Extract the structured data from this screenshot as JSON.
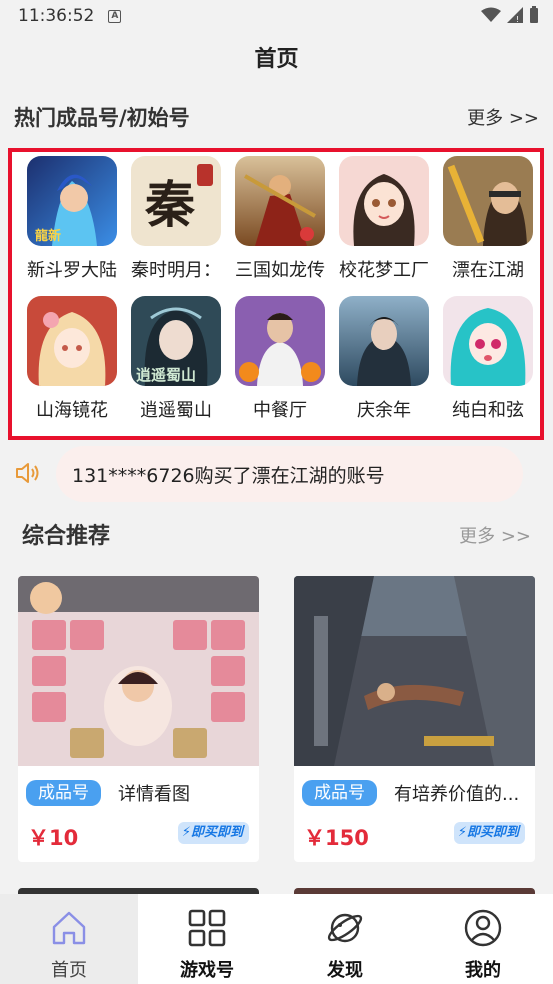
{
  "status": {
    "time": "11:36:52"
  },
  "header": {
    "title": "首页"
  },
  "hot": {
    "title": "热门成品号/初始号",
    "more": "更多 >>",
    "games": [
      {
        "name": "新斗罗大陆",
        "icon": "game-icon-xin-douluo",
        "badge": "龍新"
      },
      {
        "name": "秦时明月：",
        "icon": "game-icon-qin",
        "glyph": "秦"
      },
      {
        "name": "三国如龙传",
        "icon": "game-icon-sanguo"
      },
      {
        "name": "校花梦工厂",
        "icon": "game-icon-xiaohua"
      },
      {
        "name": "漂在江湖",
        "icon": "game-icon-piao"
      },
      {
        "name": "山海镜花",
        "icon": "game-icon-shanhai"
      },
      {
        "name": "逍遥蜀山",
        "icon": "game-icon-xiaoyao",
        "glyph": "逍遥蜀山"
      },
      {
        "name": "中餐厅",
        "icon": "game-icon-zhongcanting"
      },
      {
        "name": "庆余年",
        "icon": "game-icon-qingyunian"
      },
      {
        "name": "纯白和弦",
        "icon": "game-icon-chunbai"
      }
    ]
  },
  "notice": {
    "text": "131****6726购买了漂在江湖的账号",
    "icon": "speaker-icon"
  },
  "recommend": {
    "title": "综合推荐",
    "more": "更多 >>",
    "cards": [
      {
        "tag": "成品号",
        "desc": "详情看图",
        "price": "￥10",
        "buy": "即买即到"
      },
      {
        "tag": "成品号",
        "desc": "有培养价值的...",
        "price": "￥150",
        "buy": "即买即到"
      }
    ]
  },
  "tabs": [
    {
      "label": "首页",
      "icon": "home-icon",
      "active": true
    },
    {
      "label": "游戏号",
      "icon": "grid-icon",
      "active": false
    },
    {
      "label": "发现",
      "icon": "planet-icon",
      "active": false
    },
    {
      "label": "我的",
      "icon": "user-icon",
      "active": false
    }
  ],
  "colors": {
    "highlight_border": "#e8112d",
    "tag_blue": "#4aa0f0",
    "price_red": "#e32b3a"
  }
}
